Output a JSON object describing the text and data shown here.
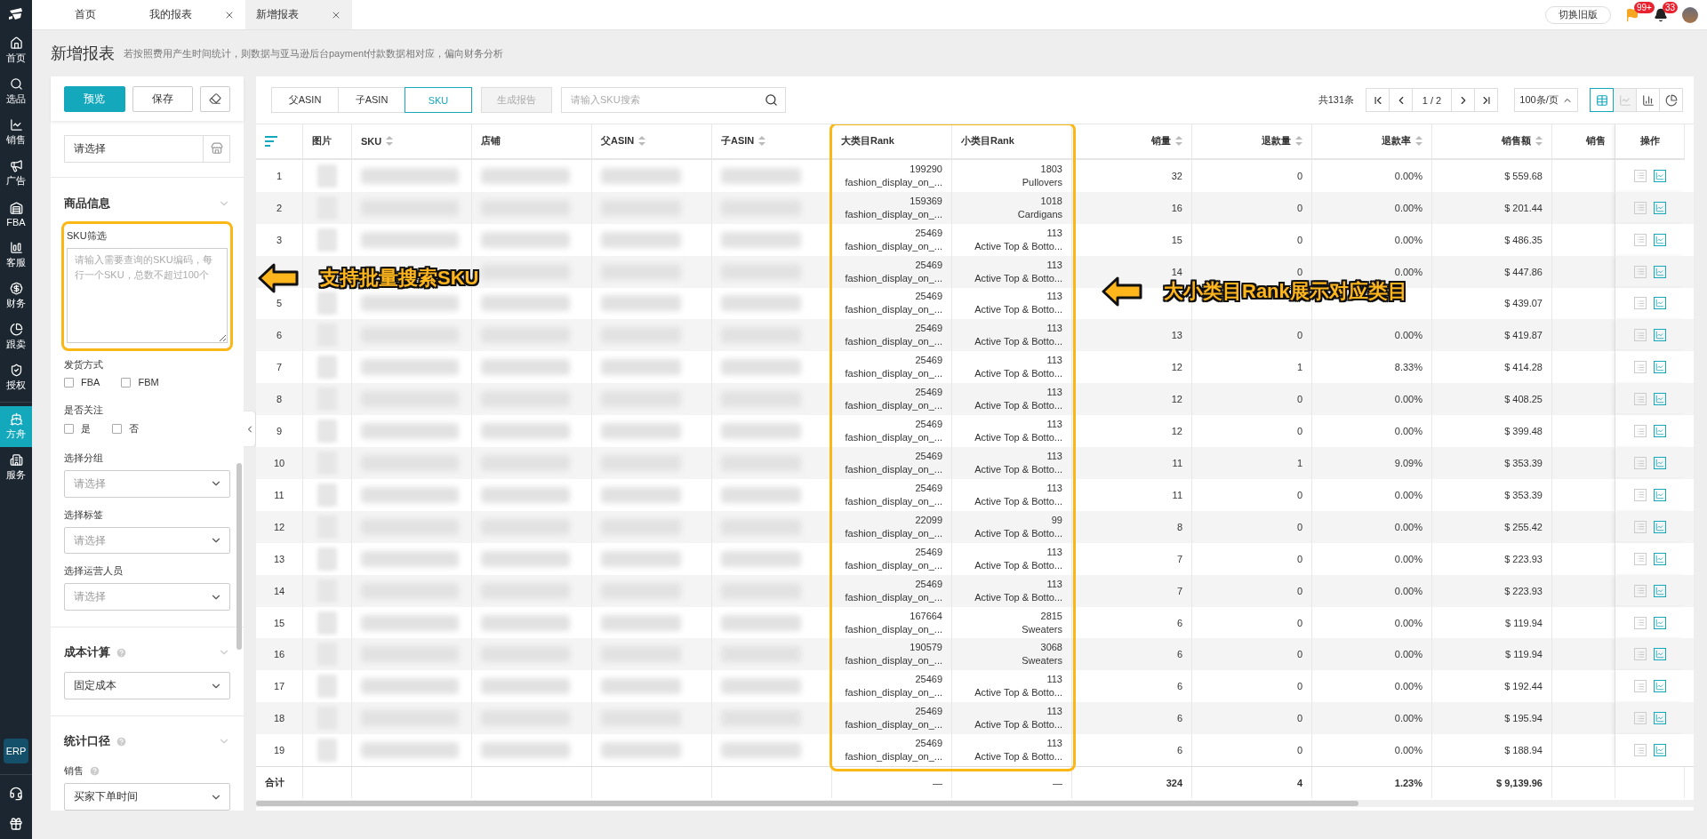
{
  "nav": {
    "items": [
      {
        "label": "首页",
        "kind": "home",
        "selected": false
      },
      {
        "label": "选品",
        "kind": "search",
        "selected": false
      },
      {
        "label": "销售",
        "kind": "sales",
        "selected": false
      },
      {
        "label": "广告",
        "kind": "ad",
        "selected": false
      },
      {
        "label": "FBA",
        "kind": "fba",
        "selected": false
      },
      {
        "label": "客服",
        "kind": "service",
        "selected": false
      },
      {
        "label": "财务",
        "kind": "finance",
        "selected": false
      },
      {
        "label": "跟卖",
        "kind": "follow",
        "selected": false
      },
      {
        "label": "授权",
        "kind": "auth",
        "selected": false
      },
      {
        "label": "方舟",
        "kind": "ark",
        "selected": true
      },
      {
        "label": "服务",
        "kind": "building",
        "selected": false
      }
    ],
    "badge": "ERP"
  },
  "tabs": [
    {
      "label": "首页",
      "closable": false,
      "selected": false
    },
    {
      "label": "我的报表",
      "closable": true,
      "selected": false
    },
    {
      "label": "新增报表",
      "closable": true,
      "selected": true
    }
  ],
  "header": {
    "switch_button": "切换旧版",
    "flag_badge": "99+",
    "bell_badge": "33"
  },
  "page": {
    "title": "新增报表",
    "subtitle": "若按照费用产生时间统计，则数据与亚马逊后台payment付款数据相对应，偏向财务分析"
  },
  "filter_panel": {
    "preview": "预览",
    "save": "保存",
    "store_placeholder": "请选择",
    "product_section": "商品信息",
    "sku_label": "SKU筛选",
    "sku_placeholder": "请输入需要查询的SKU编码，每行一个SKU，总数不超过100个",
    "shipping_label": "发货方式",
    "shipping_options": [
      {
        "label": "FBA",
        "checked": false
      },
      {
        "label": "FBM",
        "checked": false
      }
    ],
    "follow_label": "是否关注",
    "follow_options": [
      {
        "label": "是",
        "checked": false
      },
      {
        "label": "否",
        "checked": false
      }
    ],
    "selects": [
      {
        "label": "选择分组",
        "placeholder": "请选择"
      },
      {
        "label": "选择标签",
        "placeholder": "请选择"
      },
      {
        "label": "选择运营人员",
        "placeholder": "请选择"
      }
    ],
    "cost_section": "成本计算",
    "cost_value": "固定成本",
    "stat_section": "统计口径",
    "sales_label": "销售",
    "sales_value": "买家下单时间"
  },
  "toolbar": {
    "modes": [
      {
        "label": "父ASIN",
        "selected": false
      },
      {
        "label": "子ASIN",
        "selected": false
      },
      {
        "label": "SKU",
        "selected": true
      }
    ],
    "generate": {
      "label": "生成报告",
      "disabled": true
    },
    "search_placeholder": "请输入SKU搜索",
    "total": "共131条",
    "page": "1",
    "pages": "/ 2",
    "page_size": "100条/页",
    "views": [
      {
        "kind": "table",
        "selected": true,
        "disabled": false
      },
      {
        "kind": "line",
        "selected": false,
        "disabled": true
      },
      {
        "kind": "bar",
        "selected": false,
        "disabled": false
      },
      {
        "kind": "pie",
        "selected": false,
        "disabled": false
      }
    ]
  },
  "table": {
    "columns": [
      {
        "label": "图片",
        "sortable": false
      },
      {
        "label": "SKU",
        "sortable": true
      },
      {
        "label": "店铺",
        "sortable": false
      },
      {
        "label": "父ASIN",
        "sortable": true
      },
      {
        "label": "子ASIN",
        "sortable": true
      },
      {
        "label": "大类目Rank",
        "sortable": false
      },
      {
        "label": "小类目Rank",
        "sortable": false
      },
      {
        "label": "销量",
        "sortable": true
      },
      {
        "label": "退款量",
        "sortable": true
      },
      {
        "label": "退款率",
        "sortable": true
      },
      {
        "label": "销售额",
        "sortable": true
      },
      {
        "label": "销售",
        "sortable": false
      },
      {
        "label": "操作",
        "sortable": false
      }
    ],
    "rows": [
      {
        "no": "1",
        "big_rank": "199290",
        "big_category": "fashion_display_on_...",
        "small_rank": "1803",
        "small_category": "Pullovers",
        "sales": "32",
        "refunds": "0",
        "refund_rate": "0.00%",
        "revenue": "$ 559.68"
      },
      {
        "no": "2",
        "big_rank": "159369",
        "big_category": "fashion_display_on_...",
        "small_rank": "1018",
        "small_category": "Cardigans",
        "sales": "16",
        "refunds": "0",
        "refund_rate": "0.00%",
        "revenue": "$ 201.44"
      },
      {
        "no": "3",
        "big_rank": "25469",
        "big_category": "fashion_display_on_...",
        "small_rank": "113",
        "small_category": "Active Top & Botto...",
        "sales": "15",
        "refunds": "0",
        "refund_rate": "0.00%",
        "revenue": "$ 486.35"
      },
      {
        "big_rank": "25469",
        "big_category": "fashion_display_on_...",
        "small_rank": "113",
        "small_category": "Active Top & Botto...",
        "sales": "14",
        "refunds": "0",
        "refund_rate": "0.00%",
        "revenue": "$ 447.86"
      },
      {
        "no": "5",
        "big_rank": "25469",
        "big_category": "fashion_display_on_...",
        "small_rank": "113",
        "small_category": "Active Top & Botto...",
        "revenue": "$ 439.07"
      },
      {
        "no": "6",
        "big_rank": "25469",
        "big_category": "fashion_display_on_...",
        "small_rank": "113",
        "small_category": "Active Top & Botto...",
        "sales": "13",
        "refunds": "0",
        "refund_rate": "0.00%",
        "revenue": "$ 419.87"
      },
      {
        "no": "7",
        "big_rank": "25469",
        "big_category": "fashion_display_on_...",
        "small_rank": "113",
        "small_category": "Active Top & Botto...",
        "sales": "12",
        "refunds": "1",
        "refund_rate": "8.33%",
        "revenue": "$ 414.28"
      },
      {
        "no": "8",
        "big_rank": "25469",
        "big_category": "fashion_display_on_...",
        "small_rank": "113",
        "small_category": "Active Top & Botto...",
        "sales": "12",
        "refunds": "0",
        "refund_rate": "0.00%",
        "revenue": "$ 408.25"
      },
      {
        "no": "9",
        "big_rank": "25469",
        "big_category": "fashion_display_on_...",
        "small_rank": "113",
        "small_category": "Active Top & Botto...",
        "sales": "12",
        "refunds": "0",
        "refund_rate": "0.00%",
        "revenue": "$ 399.48"
      },
      {
        "no": "10",
        "big_rank": "25469",
        "big_category": "fashion_display_on_...",
        "small_rank": "113",
        "small_category": "Active Top & Botto...",
        "sales": "11",
        "refunds": "1",
        "refund_rate": "9.09%",
        "revenue": "$ 353.39"
      },
      {
        "no": "11",
        "big_rank": "25469",
        "big_category": "fashion_display_on_...",
        "small_rank": "113",
        "small_category": "Active Top & Botto...",
        "sales": "11",
        "refunds": "0",
        "refund_rate": "0.00%",
        "revenue": "$ 353.39"
      },
      {
        "no": "12",
        "big_rank": "22099",
        "big_category": "fashion_display_on_...",
        "small_rank": "99",
        "small_category": "Active Top & Botto...",
        "sales": "8",
        "refunds": "0",
        "refund_rate": "0.00%",
        "revenue": "$ 255.42"
      },
      {
        "no": "13",
        "big_rank": "25469",
        "big_category": "fashion_display_on_...",
        "small_rank": "113",
        "small_category": "Active Top & Botto...",
        "sales": "7",
        "refunds": "0",
        "refund_rate": "0.00%",
        "revenue": "$ 223.93"
      },
      {
        "no": "14",
        "big_rank": "25469",
        "big_category": "fashion_display_on_...",
        "small_rank": "113",
        "small_category": "Active Top & Botto...",
        "sales": "7",
        "refunds": "0",
        "refund_rate": "0.00%",
        "revenue": "$ 223.93"
      },
      {
        "no": "15",
        "big_rank": "167664",
        "big_category": "fashion_display_on_...",
        "small_rank": "2815",
        "small_category": "Sweaters",
        "sales": "6",
        "refunds": "0",
        "refund_rate": "0.00%",
        "revenue": "$ 119.94"
      },
      {
        "no": "16",
        "big_rank": "190579",
        "big_category": "fashion_display_on_...",
        "small_rank": "3068",
        "small_category": "Sweaters",
        "sales": "6",
        "refunds": "0",
        "refund_rate": "0.00%",
        "revenue": "$ 119.94"
      },
      {
        "no": "17",
        "big_rank": "25469",
        "big_category": "fashion_display_on_...",
        "small_rank": "113",
        "small_category": "Active Top & Botto...",
        "sales": "6",
        "refunds": "0",
        "refund_rate": "0.00%",
        "revenue": "$ 192.44"
      },
      {
        "no": "18",
        "big_rank": "25469",
        "big_category": "fashion_display_on_...",
        "small_rank": "113",
        "small_category": "Active Top & Botto...",
        "sales": "6",
        "refunds": "0",
        "refund_rate": "0.00%",
        "revenue": "$ 195.94"
      },
      {
        "no": "19",
        "big_rank": "25469",
        "big_category": "fashion_display_on_...",
        "small_rank": "113",
        "small_category": "Active Top & Botto...",
        "sales": "6",
        "refunds": "0",
        "refund_rate": "0.00%",
        "revenue": "$ 188.94"
      }
    ],
    "footer": {
      "label": "合计",
      "big_rank": "—",
      "small_rank": "—",
      "sales": "324",
      "refunds": "4",
      "refund_rate": "1.23%",
      "revenue": "$ 9,139.96"
    }
  },
  "callouts": [
    {
      "text": "支持批量搜索SKU"
    },
    {
      "text": "大小类目Rank展示对应类目"
    }
  ]
}
